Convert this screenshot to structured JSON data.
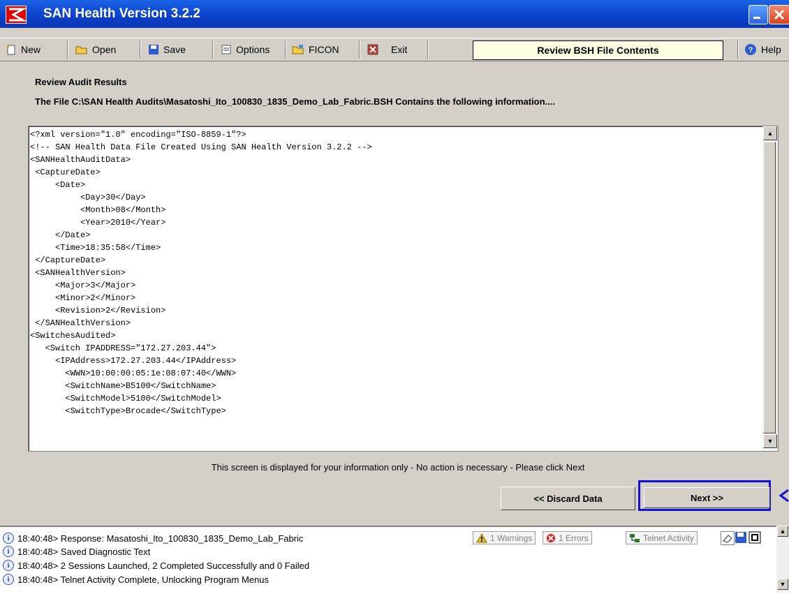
{
  "window": {
    "title": "SAN Health Version 3.2.2"
  },
  "toolbar": {
    "new": "New",
    "open": "Open",
    "save": "Save",
    "options": "Options",
    "ficon": "FICON",
    "exit": "Exit",
    "current_step": "Review BSH File Contents",
    "help": "Help"
  },
  "main": {
    "heading": "Review Audit Results",
    "file_info": "The File C:\\SAN Health Audits\\Masatoshi_Ito_100830_1835_Demo_Lab_Fabric.BSH Contains the following information....",
    "xml_lines": [
      "<?xml version=\"1.0\" encoding=\"ISO-8859-1\"?>",
      "<!-- SAN Health Data File Created Using SAN Health Version 3.2.2 -->",
      "<SANHealthAuditData>",
      " <CaptureDate>",
      "     <Date>",
      "          <Day>30</Day>",
      "          <Month>08</Month>",
      "          <Year>2010</Year>",
      "     </Date>",
      "     <Time>18:35:58</Time>",
      " </CaptureDate>",
      " <SANHealthVersion>",
      "     <Major>3</Major>",
      "     <Minor>2</Minor>",
      "     <Revision>2</Revision>",
      " </SANHealthVersion>",
      "<SwitchesAudited>",
      "   <Switch IPADDRESS=\"172.27.203.44\">",
      "     <IPAddress>172.27.203.44</IPAddress>",
      "       <WWN>10:00:00:05:1e:08:07:40</WWN>",
      "       <SwitchName>B5100</SwitchName>",
      "       <SwitchModel>5100</SwitchModel>",
      "       <SwitchType>Brocade</SwitchType>"
    ],
    "info_text": "This screen is displayed for your information only - No action is necessary - Please click Next",
    "discard_label": "<< Discard Data",
    "next_label": "Next >>"
  },
  "log": {
    "lines": [
      "18:40:48> Response: Masatoshi_Ito_100830_1835_Demo_Lab_Fabric",
      "18:40:48> Saved Diagnostic Text",
      "18:40:48> 2 Sessions Launched, 2 Completed Successfully and 0 Failed",
      "18:40:48> Telnet Activity Complete, Unlocking Program Menus"
    ],
    "warnings": "1 Warnings",
    "errors": "1 Errors",
    "telnet": "Telnet Activity"
  },
  "colors": {
    "titlebar": "#0a3fc9",
    "highlight": "#1111dd",
    "current_step_bg": "#ffffe1"
  }
}
